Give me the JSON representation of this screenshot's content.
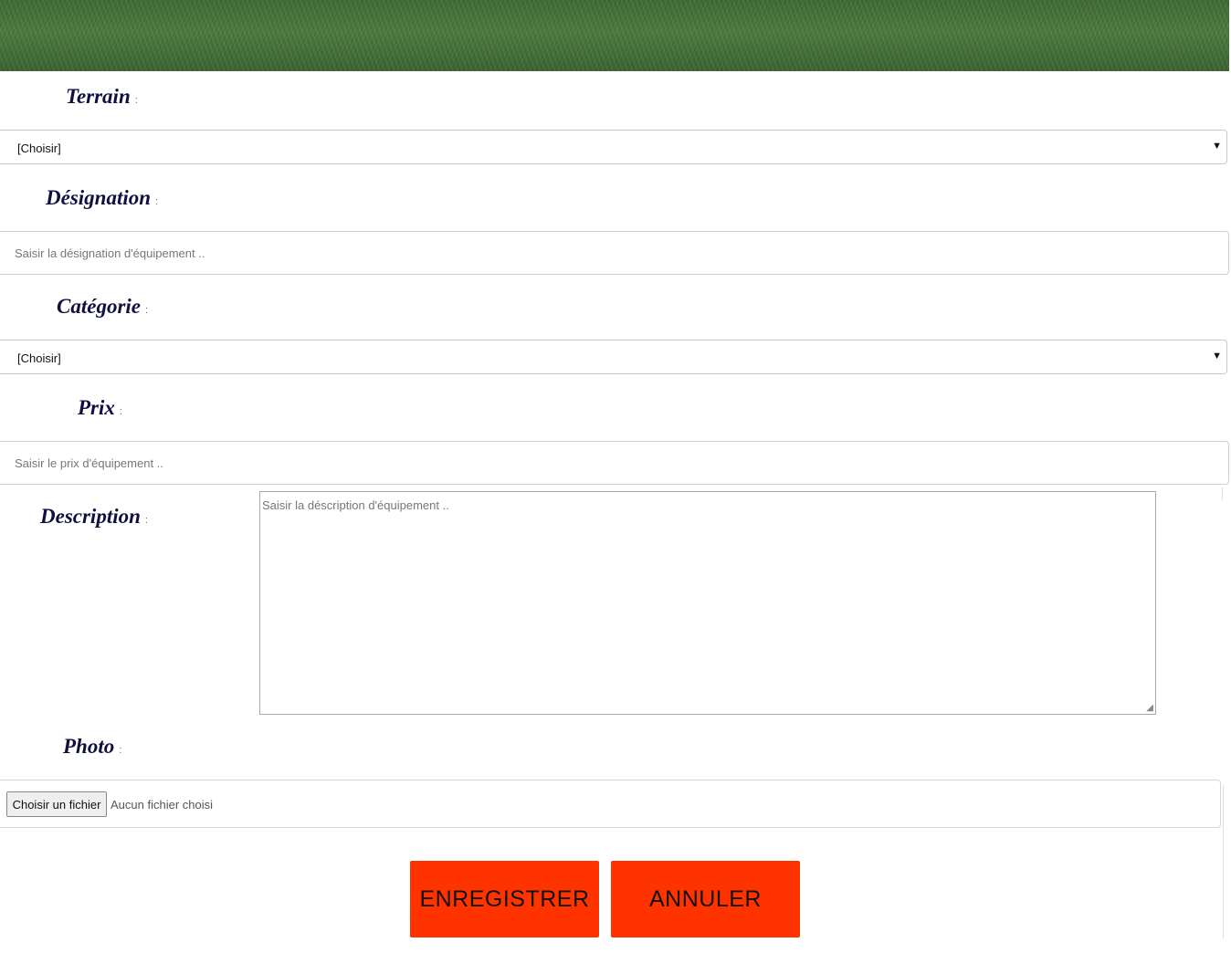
{
  "form": {
    "terrain": {
      "label": "Terrain",
      "colon": ":",
      "selected": "[Choisir]"
    },
    "designation": {
      "label": "Désignation",
      "colon": ":",
      "placeholder": "Saisir la désignation d'équipement  .."
    },
    "categorie": {
      "label": "Catégorie",
      "colon": ":",
      "selected": "[Choisir]"
    },
    "prix": {
      "label": "Prix",
      "colon": ":",
      "placeholder": "Saisir le prix d'équipement  .."
    },
    "description": {
      "label": "Description",
      "colon": ":",
      "placeholder": "Saisir la déscription d'équipement  .."
    },
    "photo": {
      "label": "Photo",
      "colon": ":",
      "button_label": "Choisir un fichier",
      "status": "Aucun fichier choisi"
    }
  },
  "actions": {
    "save_label": "ENREGISTRER",
    "cancel_label": "ANNULER"
  },
  "icons": {
    "dropdown": "caret-down-icon",
    "resize": "resize-grip-icon"
  },
  "colors": {
    "label": "#101040",
    "button": "#ff3300",
    "header_grass": "#4b7a3d"
  }
}
